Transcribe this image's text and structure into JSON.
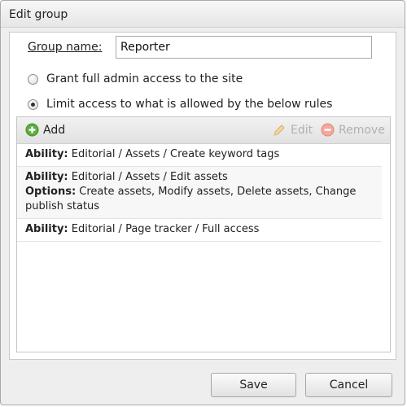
{
  "dialog": {
    "title": "Edit group"
  },
  "form": {
    "group_name_label": "Group name:",
    "group_name_value": "Reporter",
    "options": [
      {
        "label": "Grant full admin access to the site",
        "selected": false
      },
      {
        "label": "Limit access to what is allowed by the below rules",
        "selected": true
      }
    ]
  },
  "toolbar": {
    "add_label": "Add",
    "edit_label": "Edit",
    "remove_label": "Remove",
    "add_icon": "plus-circle-icon",
    "edit_icon": "pencil-icon",
    "remove_icon": "minus-circle-icon",
    "add_color": "#5cae3f",
    "remove_color": "#e87c6c"
  },
  "rules": [
    {
      "ability_label": "Ability:",
      "ability": "Editorial / Assets / Create keyword tags"
    },
    {
      "ability_label": "Ability:",
      "ability": "Editorial / Assets / Edit assets",
      "options_label": "Options:",
      "options": "Create assets, Modify assets, Delete assets, Change publish status"
    },
    {
      "ability_label": "Ability:",
      "ability": "Editorial / Page tracker / Full access"
    }
  ],
  "footer": {
    "save_label": "Save",
    "cancel_label": "Cancel"
  }
}
